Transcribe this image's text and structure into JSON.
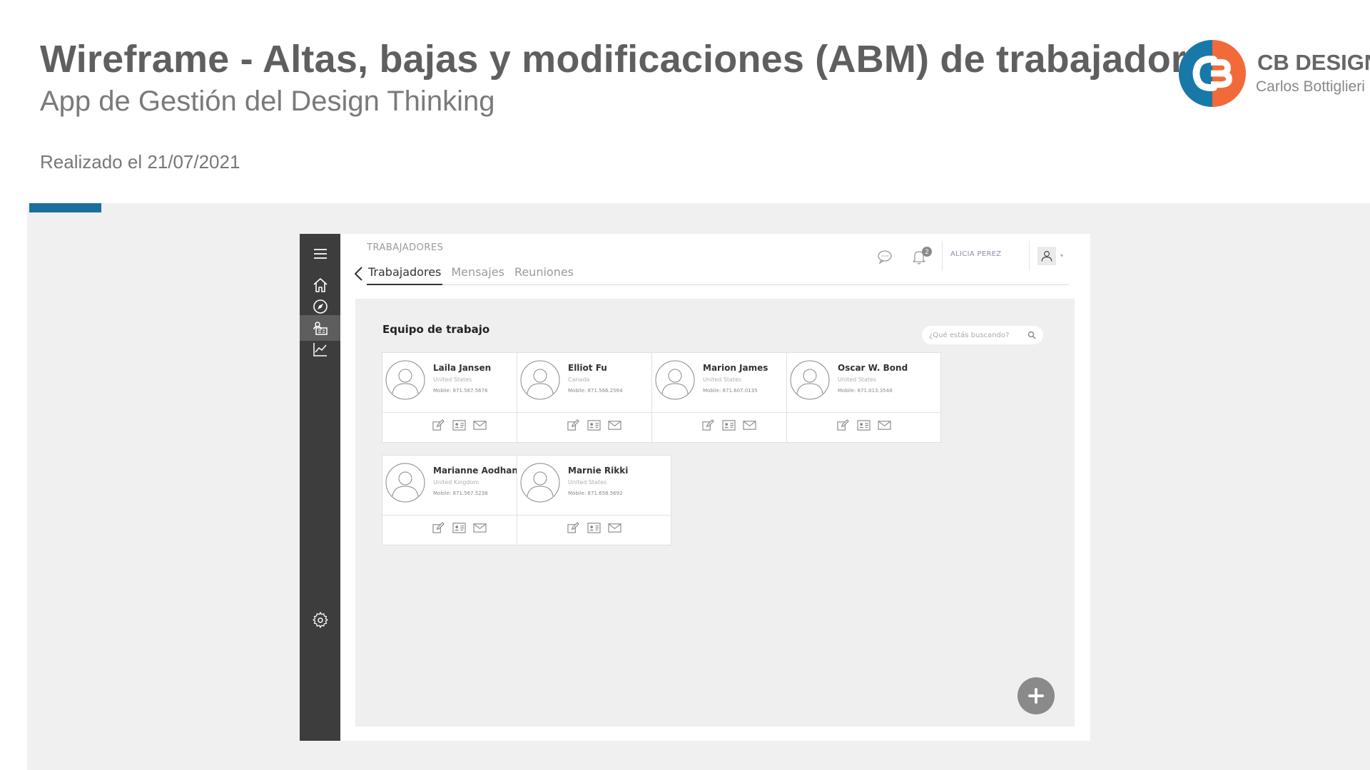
{
  "header": {
    "title": "Wireframe - Altas, bajas y modificaciones (ABM) de trabajadores",
    "subtitle": "App de Gestión del Design Thinking",
    "date": "Realizado el 21/07/2021"
  },
  "brand": {
    "name": "CB DESIGN",
    "person": "Carlos Bottiglieri",
    "colors": {
      "orange": "#f26a3a",
      "blue": "#1878a8"
    }
  },
  "colors": {
    "accent_bar": "#1a6f9c",
    "sidebar": "#3d3d3d",
    "stage": "#f0f0f0"
  },
  "app": {
    "sidebar": {
      "icons": [
        "menu-icon",
        "home-icon",
        "compass-icon",
        "workers-icon",
        "chart-icon",
        "gear-icon"
      ],
      "active": "workers-icon"
    },
    "section_label": "TRABAJADORES",
    "tabs": [
      {
        "label": "Trabajadores",
        "active": true
      },
      {
        "label": "Mensajes",
        "active": false
      },
      {
        "label": "Reuniones",
        "active": false
      }
    ],
    "notification_count": "2",
    "user_name": "ALICIA PEREZ",
    "content_title": "Equipo de trabajo",
    "search_placeholder": "¿Qué estás buscando?",
    "workers": [
      {
        "name": "Laila Jansen",
        "country": "United States",
        "mobile": "Mobile: 871.567.5676"
      },
      {
        "name": "Elliot Fu",
        "country": "Canada",
        "mobile": "Mobile: 871.566.2564"
      },
      {
        "name": "Marion James",
        "country": "United States",
        "mobile": "Mobile: 871.607.0135"
      },
      {
        "name": "Oscar W. Bond",
        "country": "United States",
        "mobile": "Mobile: 871.013.3548"
      },
      {
        "name": "Marianne Aodhan",
        "country": "United Kingdom",
        "mobile": "Mobile: 871.567.5238"
      },
      {
        "name": "Marnie Rikki",
        "country": "United States",
        "mobile": "Mobile: 871.658.5692"
      }
    ],
    "card_actions": [
      "edit-icon",
      "id-card-icon",
      "mail-icon"
    ],
    "fab": "plus-icon"
  }
}
